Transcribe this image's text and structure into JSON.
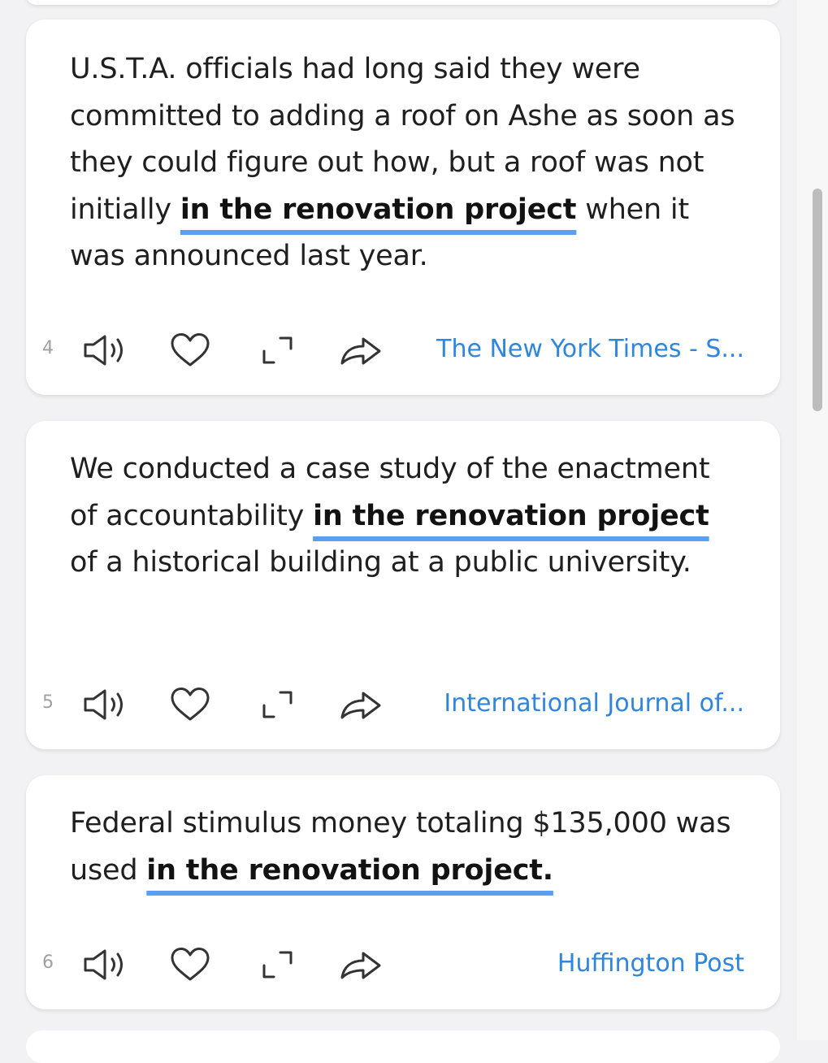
{
  "cards": [
    {
      "number": "4",
      "before": "U.S.T.A. officials had long said they were committed to adding a roof on Ashe as soon as they could figure out how, but a roof was not initially ",
      "highlight": "in the renovation project",
      "after": " when it was announced last year.",
      "source": "The New York Times - S..."
    },
    {
      "number": "5",
      "before": "We conducted a case study of the enactment of accountability ",
      "highlight": "in the renovation project",
      "after": " of a historical building at a public university.",
      "source": "International Journal of..."
    },
    {
      "number": "6",
      "before": "Federal stimulus money totaling $135,000 was used ",
      "highlight": "in the renovation project.",
      "after": "",
      "source": "Huffington Post"
    }
  ],
  "icons": {
    "speaker": "speaker-icon",
    "heart": "heart-icon",
    "expand": "expand-icon",
    "share": "share-icon"
  },
  "colors": {
    "accent": "#2f86dc",
    "underline": "#5b9ff0",
    "background": "#f2f2f4",
    "card": "#ffffff"
  }
}
